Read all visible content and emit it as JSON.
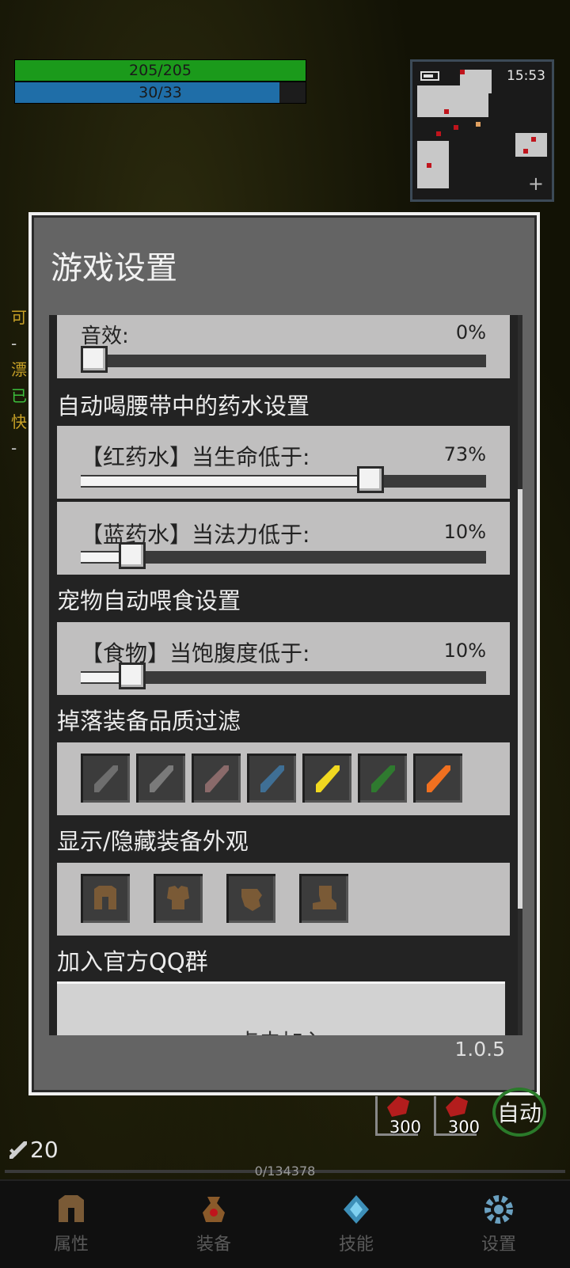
{
  "hud": {
    "hp_text": "205/205",
    "hp_fraction": 1.0,
    "mp_text": "30/33",
    "mp_fraction": 0.909,
    "clock": "15:53",
    "side_letters": [
      "可",
      "-",
      "漂",
      "已",
      "快",
      "-"
    ],
    "attack_value": "20",
    "exp_text": "0/134378",
    "quick_slots": [
      {
        "count": "300",
        "icon": "red-potion-icon"
      },
      {
        "count": "300",
        "icon": "red-potion-icon"
      }
    ],
    "auto_label": "自动"
  },
  "dialog": {
    "title": "游戏设置",
    "version": "1.0.5",
    "sound": {
      "label": "音效:",
      "value_text": "0%",
      "value": 0
    },
    "potion_section": "自动喝腰带中的药水设置",
    "red_potion": {
      "label": "【红药水】当生命低于:",
      "value_text": "73%",
      "value": 73
    },
    "blue_potion": {
      "label": "【蓝药水】当法力低于:",
      "value_text": "10%",
      "value": 10
    },
    "pet_section": "宠物自动喂食设置",
    "food": {
      "label": "【食物】当饱腹度低于:",
      "value_text": "10%",
      "value": 10
    },
    "filter_section": "掉落装备品质过滤",
    "quality_icons": [
      {
        "name": "gray-sword-icon",
        "color": "#6e6e6e",
        "enabled": false
      },
      {
        "name": "gray-sword-icon",
        "color": "#7a7a7a",
        "enabled": false
      },
      {
        "name": "brown-sword-icon",
        "color": "#8a6a6a",
        "enabled": false
      },
      {
        "name": "blue-sword-icon",
        "color": "#3f6f95",
        "enabled": false
      },
      {
        "name": "yellow-sword-icon",
        "color": "#f0d820",
        "enabled": true
      },
      {
        "name": "green-sword-icon",
        "color": "#2f7a2f",
        "enabled": false
      },
      {
        "name": "orange-sword-icon",
        "color": "#f07020",
        "enabled": true
      }
    ],
    "appearance_section": "显示/隐藏装备外观",
    "appearance_icons": [
      "helmet-icon",
      "armor-icon",
      "glove-icon",
      "boots-icon"
    ],
    "qq_section": "加入官方QQ群",
    "join_button": "点击加入"
  },
  "nav": {
    "items": [
      {
        "label": "属性",
        "icon": "helmet-icon"
      },
      {
        "label": "装备",
        "icon": "bag-icon"
      },
      {
        "label": "技能",
        "icon": "skill-gem-icon"
      },
      {
        "label": "设置",
        "icon": "gear-icon"
      }
    ]
  }
}
